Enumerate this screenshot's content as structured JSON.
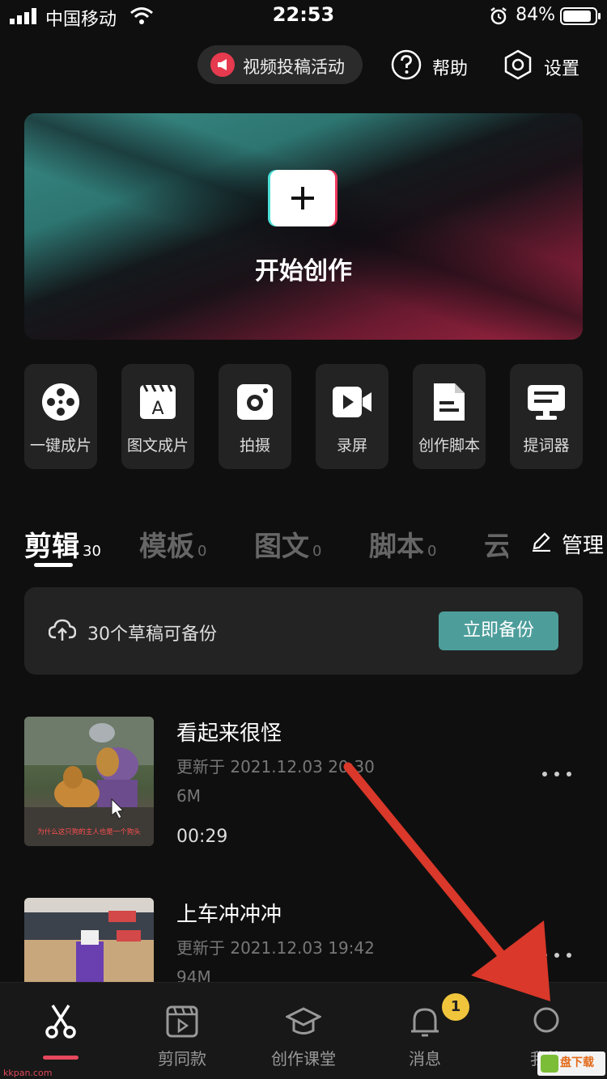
{
  "status_bar": {
    "carrier": "中国移动",
    "time": "22:53",
    "battery": "84%"
  },
  "header": {
    "activity_label": "视频投稿活动",
    "help_label": "帮助",
    "settings_label": "设置"
  },
  "hero": {
    "label": "开始创作"
  },
  "tools": [
    {
      "label": "一键成片",
      "icon": "film-reel-icon"
    },
    {
      "label": "图文成片",
      "icon": "text-clapper-icon"
    },
    {
      "label": "拍摄",
      "icon": "camera-icon"
    },
    {
      "label": "录屏",
      "icon": "screen-record-icon"
    },
    {
      "label": "创作脚本",
      "icon": "script-document-icon"
    },
    {
      "label": "提词器",
      "icon": "teleprompter-icon"
    }
  ],
  "tabs": [
    {
      "name": "剪辑",
      "count": "30"
    },
    {
      "name": "模板",
      "count": "0"
    },
    {
      "name": "图文",
      "count": "0"
    },
    {
      "name": "脚本",
      "count": "0"
    },
    {
      "name": "云",
      "count": ""
    }
  ],
  "manage_label": "管理",
  "backup": {
    "text": "30个草稿可备份",
    "button": "立即备份"
  },
  "drafts": [
    {
      "title": "看起来很怪",
      "updated": "更新于 2021.12.03 20:30",
      "size": "6M",
      "duration": "00:29",
      "caption": "为什么这只狗的主人也是一个狗头"
    },
    {
      "title": "上车冲冲冲",
      "updated": "更新于 2021.12.03 19:42",
      "size": "94M",
      "duration": ""
    }
  ],
  "bottom_nav": [
    {
      "label": "",
      "icon": "scissors-icon"
    },
    {
      "label": "剪同款",
      "icon": "template-play-icon"
    },
    {
      "label": "创作课堂",
      "icon": "graduation-cap-icon"
    },
    {
      "label": "消息",
      "icon": "bell-icon"
    },
    {
      "label": "我的",
      "icon": "profile-icon"
    }
  ],
  "notification_count": "1",
  "watermark": "盘下载",
  "watermark_url": "kkpan.com",
  "colors": {
    "accent_teal": "#4d9e9b",
    "accent_red": "#e6485d",
    "badge_yellow": "#f0c53c",
    "arrow_red": "#d9382a"
  }
}
